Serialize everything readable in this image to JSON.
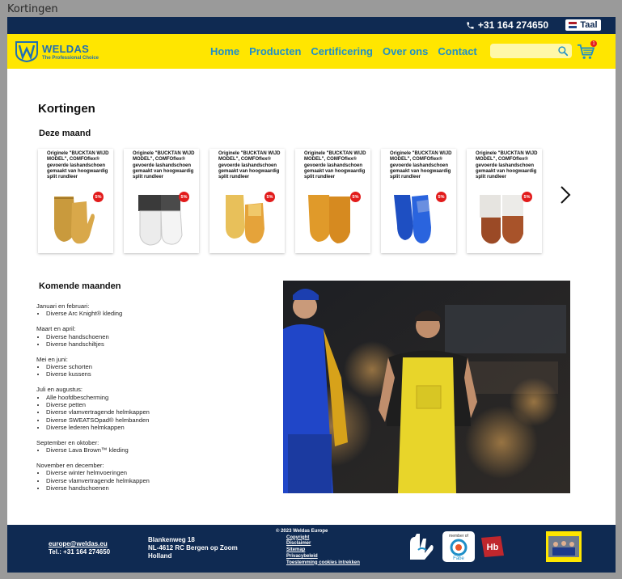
{
  "window": {
    "title": "Kortingen"
  },
  "topbar": {
    "phone": "+31 164 274650",
    "language": "Taal"
  },
  "brand": {
    "name": "WELDAS",
    "tagline": "The Professional Choice"
  },
  "nav": [
    "Home",
    "Producten",
    "Certificering",
    "Over ons",
    "Contact"
  ],
  "search": {
    "placeholder": ""
  },
  "cart": {
    "count": "1"
  },
  "page": {
    "title": "Kortingen",
    "this_month": "Deze maand",
    "upcoming": "Komende maanden"
  },
  "products": [
    {
      "title": "Originele \"BUCKTAN WIJD MODEL\", COMFOflex® gevoerde lashandschoen gemaakt van hoogwaardig split rundleer",
      "discount": "5%",
      "image": "tan-leather-glove"
    },
    {
      "title": "Originele \"BUCKTAN WIJD MODEL\", COMFOflex® gevoerde lashandschoen gemaakt van hoogwaardig split rundleer",
      "discount": "5%",
      "image": "white-grey-tig-glove"
    },
    {
      "title": "Originele \"BUCKTAN WIJD MODEL\", COMFOflex® gevoerde lashandschoen gemaakt van hoogwaardig split rundleer",
      "discount": "5%",
      "image": "yellow-leather-glove"
    },
    {
      "title": "Originele \"BUCKTAN WIJD MODEL\", COMFOflex® gevoerde lashandschoen gemaakt van hoogwaardig split rundleer",
      "discount": "5%",
      "image": "orange-leather-glove"
    },
    {
      "title": "Originele \"BUCKTAN WIJD MODEL\", COMFOflex® gevoerde lashandschoen gemaakt van hoogwaardig split rundleer",
      "discount": "5%",
      "image": "blue-leather-glove"
    },
    {
      "title": "Originele \"BUCKTAN WIJD MODEL\", COMFOflex® gevoerde lashandschoen gemaakt van hoogwaardig split rundleer",
      "discount": "5%",
      "image": "brown-white-glove"
    }
  ],
  "months": [
    {
      "period": "Januari en februari:",
      "items": [
        "Diverse Arc Knight® kleding"
      ]
    },
    {
      "period": "Maart en april:",
      "items": [
        "Diverse handschoenen",
        "Diverse handschiltjes"
      ]
    },
    {
      "period": "Mei en juni:",
      "items": [
        "Diverse schorten",
        "Diverse kussens"
      ]
    },
    {
      "period": "Juli en augustus:",
      "items": [
        "Alle hoofdbescherming",
        "Diverse petten",
        "Diverse vlamvertragende helmkappen",
        "Diverse SWEATSOpad® helmbanden",
        "Diverse lederen helmkappen"
      ]
    },
    {
      "period": "September en oktober:",
      "items": [
        "Diverse Lava Brown™ kleding"
      ]
    },
    {
      "period": "November en december:",
      "items": [
        "Diverse winter helmvoeringen",
        "Diverse vlamvertragende helmkappen",
        "Diverse handschoenen"
      ]
    }
  ],
  "footer": {
    "email": "europe@weldas.eu",
    "tel": "Tel.: +31 164 274650",
    "address": [
      "Blankenweg 18",
      "NL-4612 RC Bergen op Zoom",
      "Holland"
    ],
    "copyright": "© 2023 Weldas Europe",
    "links": [
      "Copyright",
      "Disclaimer",
      "Sitemap",
      "Privacybeleid",
      "Toestemming cookies intrekken"
    ],
    "logo_labels": {
      "member": "member of",
      "fabric": "Fabe",
      "hb": "Hb"
    }
  },
  "colors": {
    "navy": "#0f2a52",
    "yellow": "#ffe600",
    "nav_blue": "#1e8fc8",
    "badge_red": "#e21b1b"
  }
}
